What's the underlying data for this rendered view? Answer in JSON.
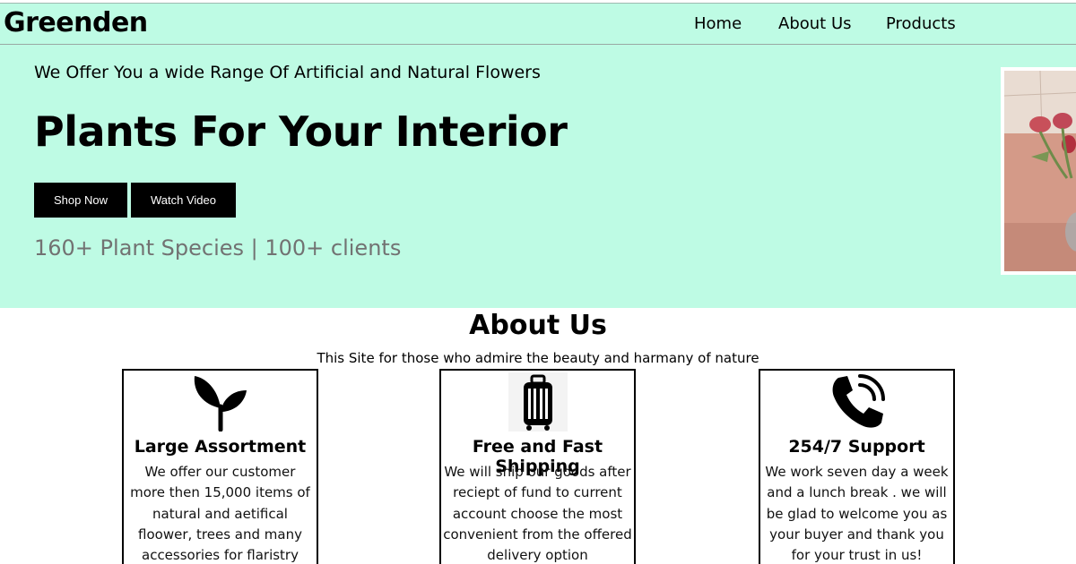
{
  "header": {
    "logo": "Greenden",
    "nav": [
      {
        "label": "Home"
      },
      {
        "label": "About Us"
      },
      {
        "label": "Products"
      }
    ]
  },
  "hero": {
    "tagline": "We Offer You a wide Range Of Artificial and Natural Flowers",
    "title": "Plants For Your Interior",
    "buttons": {
      "shop": "Shop Now",
      "watch": "Watch Video"
    },
    "stats": "160+ Plant Species | 100+ clients"
  },
  "about": {
    "title": "About Us",
    "subtitle": "This Site for those who admire the beauty and harmany of nature",
    "cards": [
      {
        "icon": "sprout-icon",
        "title": "Large Assortment",
        "text": "We offer our customer more then 15,000 items of natural and aetifical floower, trees and many accessories for flaristry"
      },
      {
        "icon": "luggage-icon",
        "title": "Free and Fast Shipping",
        "text": "We will ship our goods after reciept of fund to current account choose the most convenient from the offered delivery option"
      },
      {
        "icon": "phone-ringing-icon",
        "title": "254/7 Support",
        "text": "We work seven day a week and a lunch break . we will be glad to welcome you as your buyer and thank you for your trust in us!"
      }
    ]
  },
  "colors": {
    "mint": "#befbe4",
    "button": "#000000",
    "stats_gray": "#727272"
  }
}
